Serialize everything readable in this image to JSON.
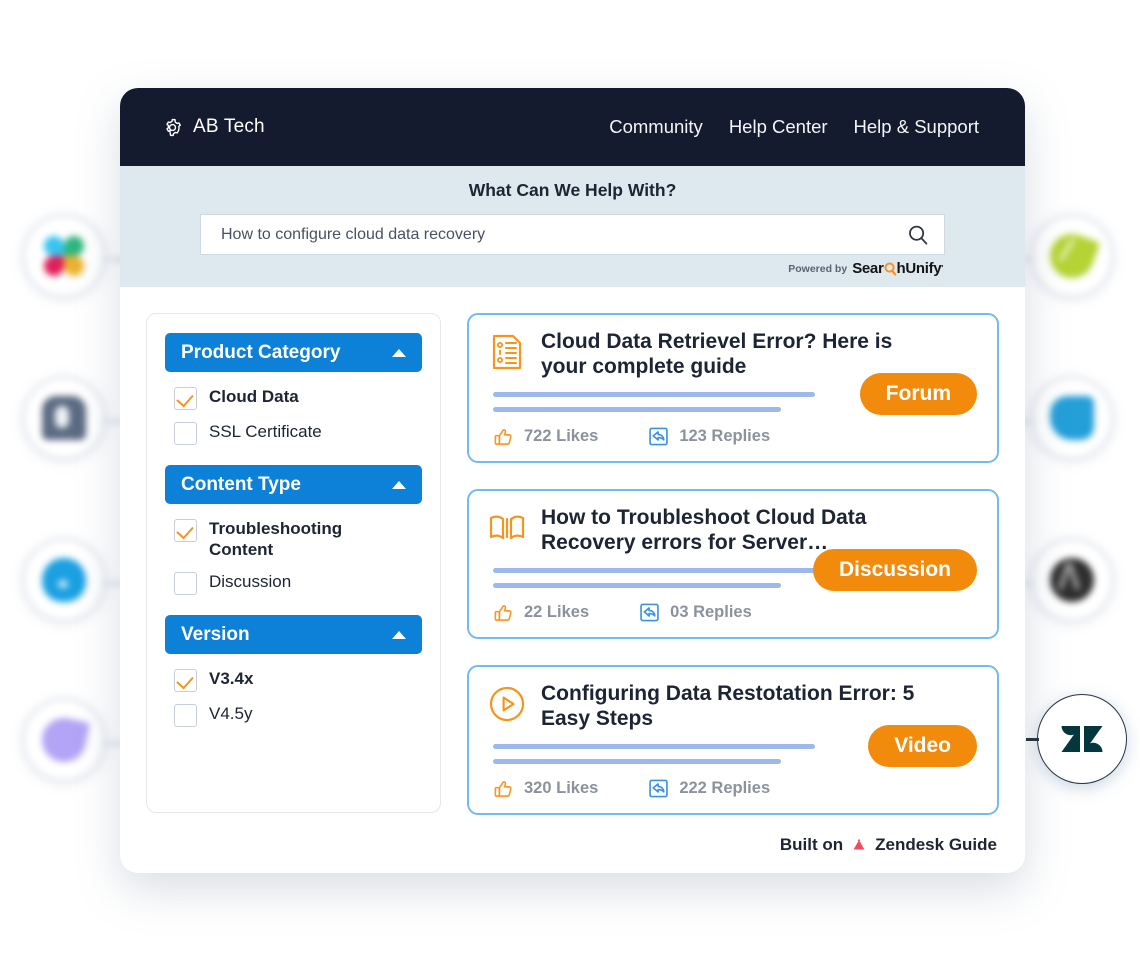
{
  "header": {
    "brand": "AB Tech",
    "brand_icon": "gear-icon",
    "nav": [
      {
        "label": "Community"
      },
      {
        "label": "Help Center"
      },
      {
        "label": "Help & Support"
      }
    ],
    "bg_color": "#151b2e"
  },
  "search": {
    "heading": "What Can We Help With?",
    "value": "How to configure cloud data recovery",
    "placeholder": "Search",
    "icon": "search-icon",
    "powered_by_prefix": "Powered by",
    "powered_by_brand_pre": "Sear",
    "powered_by_brand_post": "hUnify",
    "powered_by_tm": "'",
    "band_color": "#dee8ef"
  },
  "sidebar": {
    "groups": [
      {
        "title": "Product Category",
        "collapse_icon": "chevron-up-icon",
        "options": [
          {
            "label": "Cloud Data",
            "checked": true
          },
          {
            "label": "SSL Certificate",
            "checked": false
          }
        ]
      },
      {
        "title": "Content Type",
        "collapse_icon": "chevron-up-icon",
        "options": [
          {
            "label": "Troubleshooting Content",
            "checked": true
          },
          {
            "label": "Discussion",
            "checked": false
          }
        ]
      },
      {
        "title": "Version",
        "collapse_icon": "chevron-up-icon",
        "options": [
          {
            "label": "V3.4x",
            "checked": true
          },
          {
            "label": "V4.5y",
            "checked": false
          }
        ]
      }
    ],
    "accent_color": "#0d80d8",
    "check_color": "#f7941e"
  },
  "results": [
    {
      "icon": "document-list-icon",
      "title": "Cloud Data Retrievel Error? Here is your complete guide",
      "badge": "Forum",
      "likes": "722 Likes",
      "replies": "123 Replies",
      "likes_icon": "thumbs-up-icon",
      "replies_icon": "reply-icon"
    },
    {
      "icon": "book-icon",
      "title": "How to Troubleshoot Cloud Data Recovery errors for Server…",
      "badge": "Discussion",
      "likes": "22 Likes",
      "replies": "03 Replies",
      "likes_icon": "thumbs-up-icon",
      "replies_icon": "reply-icon"
    },
    {
      "icon": "play-circle-icon",
      "title": "Configuring Data Restotation Error: 5 Easy Steps",
      "badge": "Video",
      "likes": "320 Likes",
      "replies": "222 Replies",
      "likes_icon": "thumbs-up-icon",
      "replies_icon": "reply-icon"
    }
  ],
  "footer": {
    "built_on": "Built on",
    "zendesk_label": "Zendesk Guide",
    "zendesk_icon": "zendesk-triangle-icon",
    "triangle_color": "#ef4a5e"
  },
  "zendesk_widget": {
    "icon": "zendesk-logo-icon",
    "color": "#03363d"
  },
  "background_badges": {
    "left": [
      "slack-logo-icon",
      "person-logo-icon",
      "water-drop-logo-icon",
      "purple-shape-logo-icon"
    ],
    "right": [
      "green-leaf-logo-icon",
      "blue-blob-logo-icon",
      "dark-logo-icon"
    ]
  },
  "colors": {
    "pill": "#f28b0c",
    "card_border": "#74baee",
    "placeholder_line": "#9cb8ec"
  }
}
